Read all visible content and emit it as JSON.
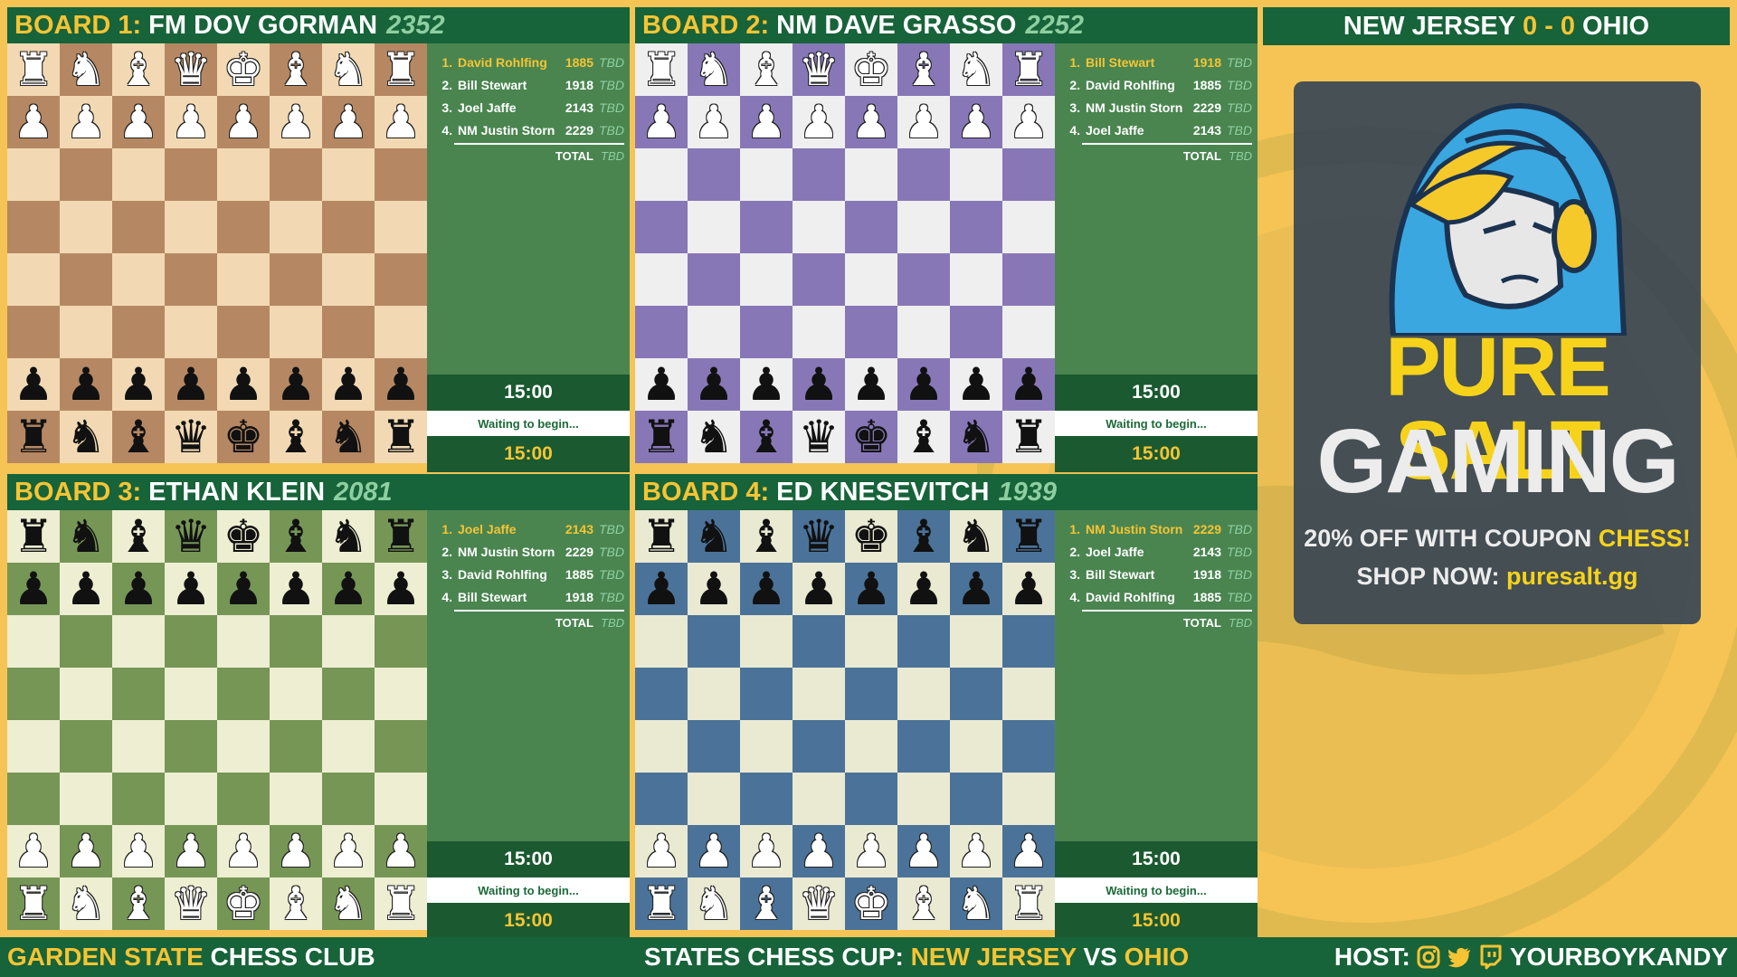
{
  "scoreboard": {
    "team_a": "NEW JERSEY",
    "score_a": "0",
    "sep": "-",
    "score_b": "0",
    "team_b": "OHIO"
  },
  "boards": [
    {
      "label": "BOARD 1:",
      "player": "FM DOV GORMAN",
      "rating": "2352",
      "colors": {
        "light": "#f2d9b3",
        "dark": "#b58863"
      },
      "lineup": [
        {
          "num": "1.",
          "name": "David Rohlfing",
          "rating": "1885",
          "result": "TBD",
          "active": true
        },
        {
          "num": "2.",
          "name": "Bill Stewart",
          "rating": "1918",
          "result": "TBD",
          "active": false
        },
        {
          "num": "3.",
          "name": "Joel Jaffe",
          "rating": "2143",
          "result": "TBD",
          "active": false
        },
        {
          "num": "4.",
          "name": "NM Justin Storn",
          "rating": "2229",
          "result": "TBD",
          "active": false
        }
      ],
      "total_label": "TOTAL",
      "total_value": "TBD",
      "clock_top": "15:00",
      "status": "Waiting to begin...",
      "clock_bottom": "15:00",
      "top_side": "white"
    },
    {
      "label": "BOARD 2:",
      "player": "NM DAVE GRASSO",
      "rating": "2252",
      "colors": {
        "light": "#efefef",
        "dark": "#8877b7"
      },
      "lineup": [
        {
          "num": "1.",
          "name": "Bill Stewart",
          "rating": "1918",
          "result": "TBD",
          "active": true
        },
        {
          "num": "2.",
          "name": "David Rohlfing",
          "rating": "1885",
          "result": "TBD",
          "active": false
        },
        {
          "num": "3.",
          "name": "NM Justin Storn",
          "rating": "2229",
          "result": "TBD",
          "active": false
        },
        {
          "num": "4.",
          "name": "Joel Jaffe",
          "rating": "2143",
          "result": "TBD",
          "active": false
        }
      ],
      "total_label": "TOTAL",
      "total_value": "TBD",
      "clock_top": "15:00",
      "status": "Waiting to begin...",
      "clock_bottom": "15:00",
      "top_side": "white"
    },
    {
      "label": "BOARD 3:",
      "player": "ETHAN KLEIN",
      "rating": "2081",
      "colors": {
        "light": "#eeeed2",
        "dark": "#769656"
      },
      "lineup": [
        {
          "num": "1.",
          "name": "Joel Jaffe",
          "rating": "2143",
          "result": "TBD",
          "active": true
        },
        {
          "num": "2.",
          "name": "NM Justin Storn",
          "rating": "2229",
          "result": "TBD",
          "active": false
        },
        {
          "num": "3.",
          "name": "David Rohlfing",
          "rating": "1885",
          "result": "TBD",
          "active": false
        },
        {
          "num": "4.",
          "name": "Bill Stewart",
          "rating": "1918",
          "result": "TBD",
          "active": false
        }
      ],
      "total_label": "TOTAL",
      "total_value": "TBD",
      "clock_top": "15:00",
      "status": "Waiting to begin...",
      "clock_bottom": "15:00",
      "top_side": "black"
    },
    {
      "label": "BOARD 4:",
      "player": "ED KNESEVITCH",
      "rating": "1939",
      "colors": {
        "light": "#eae9d2",
        "dark": "#4b7399"
      },
      "lineup": [
        {
          "num": "1.",
          "name": "NM Justin Storn",
          "rating": "2229",
          "result": "TBD",
          "active": true
        },
        {
          "num": "2.",
          "name": "Joel Jaffe",
          "rating": "2143",
          "result": "TBD",
          "active": false
        },
        {
          "num": "3.",
          "name": "Bill Stewart",
          "rating": "1918",
          "result": "TBD",
          "active": false
        },
        {
          "num": "4.",
          "name": "David Rohlfing",
          "rating": "1885",
          "result": "TBD",
          "active": false
        }
      ],
      "total_label": "TOTAL",
      "total_value": "TBD",
      "clock_top": "15:00",
      "status": "Waiting to begin...",
      "clock_bottom": "15:00",
      "top_side": "black"
    }
  ],
  "ad": {
    "line1": "PURE SALT",
    "line2": "GAMING",
    "coupon_prefix": "20% OFF WITH COUPON",
    "coupon_code": "CHESS!",
    "shop_prefix": "SHOP NOW:",
    "shop_url": "puresalt.gg",
    "accent": "#f6d31a"
  },
  "footer": {
    "club_a": "GARDEN STATE",
    "club_b": "CHESS CLUB",
    "event_prefix": "STATES CHESS CUP:",
    "team_a": "NEW JERSEY",
    "vs": "VS",
    "team_b": "OHIO",
    "host_label": "HOST:",
    "host_handle": "YOURBOYKANDY",
    "icons": [
      "instagram-icon",
      "twitter-icon",
      "twitch-icon"
    ]
  },
  "theme": {
    "green": "#17633a",
    "panel_green": "#4a8550",
    "yellow": "#f6c433",
    "background": "#f6c455"
  }
}
